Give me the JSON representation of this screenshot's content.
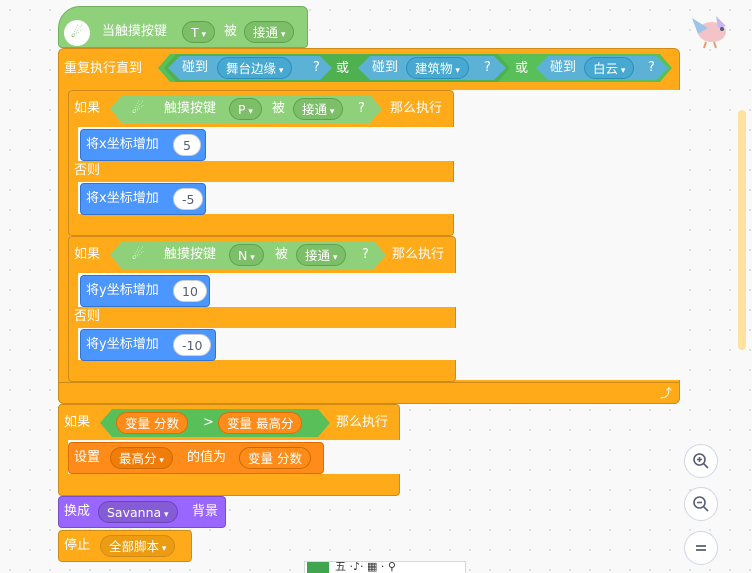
{
  "colors": {
    "control": "#ffab19",
    "events": "#ffbf00",
    "sensing": "#5cb1d6",
    "motion": "#4c97ff",
    "operators": "#59c059",
    "variables": "#ff8c1a",
    "looks": "#9966ff",
    "extension": "#8fd17a"
  },
  "hat": {
    "label_when": "当触摸按键",
    "key": "T",
    "label_is": "被",
    "state": "接通"
  },
  "repeat_until": {
    "label": "重复执行直到",
    "or_label": "或",
    "touch_label": "碰到",
    "targets": [
      "舞台边缘",
      "建筑物",
      "白云"
    ],
    "q": "?"
  },
  "if1": {
    "if_label": "如果",
    "then_label": "那么执行",
    "else_label": "否则",
    "cond": {
      "label": "触摸按键",
      "key": "P",
      "is": "被",
      "state": "接通",
      "q": "?"
    },
    "then_block": {
      "label": "将x坐标增加",
      "value": "5"
    },
    "else_block": {
      "label": "将x坐标增加",
      "value": "-5"
    }
  },
  "if2": {
    "if_label": "如果",
    "then_label": "那么执行",
    "else_label": "否则",
    "cond": {
      "label": "触摸按键",
      "key": "N",
      "is": "被",
      "state": "接通",
      "q": "?"
    },
    "then_block": {
      "label": "将y坐标增加",
      "value": "10"
    },
    "else_block": {
      "label": "将y坐标增加",
      "value": "-10"
    }
  },
  "loop_arrow": "⤴",
  "if3": {
    "if_label": "如果",
    "then_label": "那么执行",
    "left": "变量 分数",
    "op": ">",
    "right": "变量 最高分",
    "set": {
      "label": "设置",
      "var": "最高分",
      "mid": "的值为",
      "value": "变量 分数"
    }
  },
  "switch_bg": {
    "label": "换成",
    "value": "Savanna",
    "suffix": "背景"
  },
  "stop": {
    "label": "停止",
    "value": "全部脚本"
  },
  "zoom": {
    "in_icon": "zoom-in-icon",
    "out_icon": "zoom-out-icon",
    "reset_icon": "zoom-reset-icon"
  },
  "bottom_bar": {
    "text": "五 ·♪· ▦ · ⚲"
  }
}
